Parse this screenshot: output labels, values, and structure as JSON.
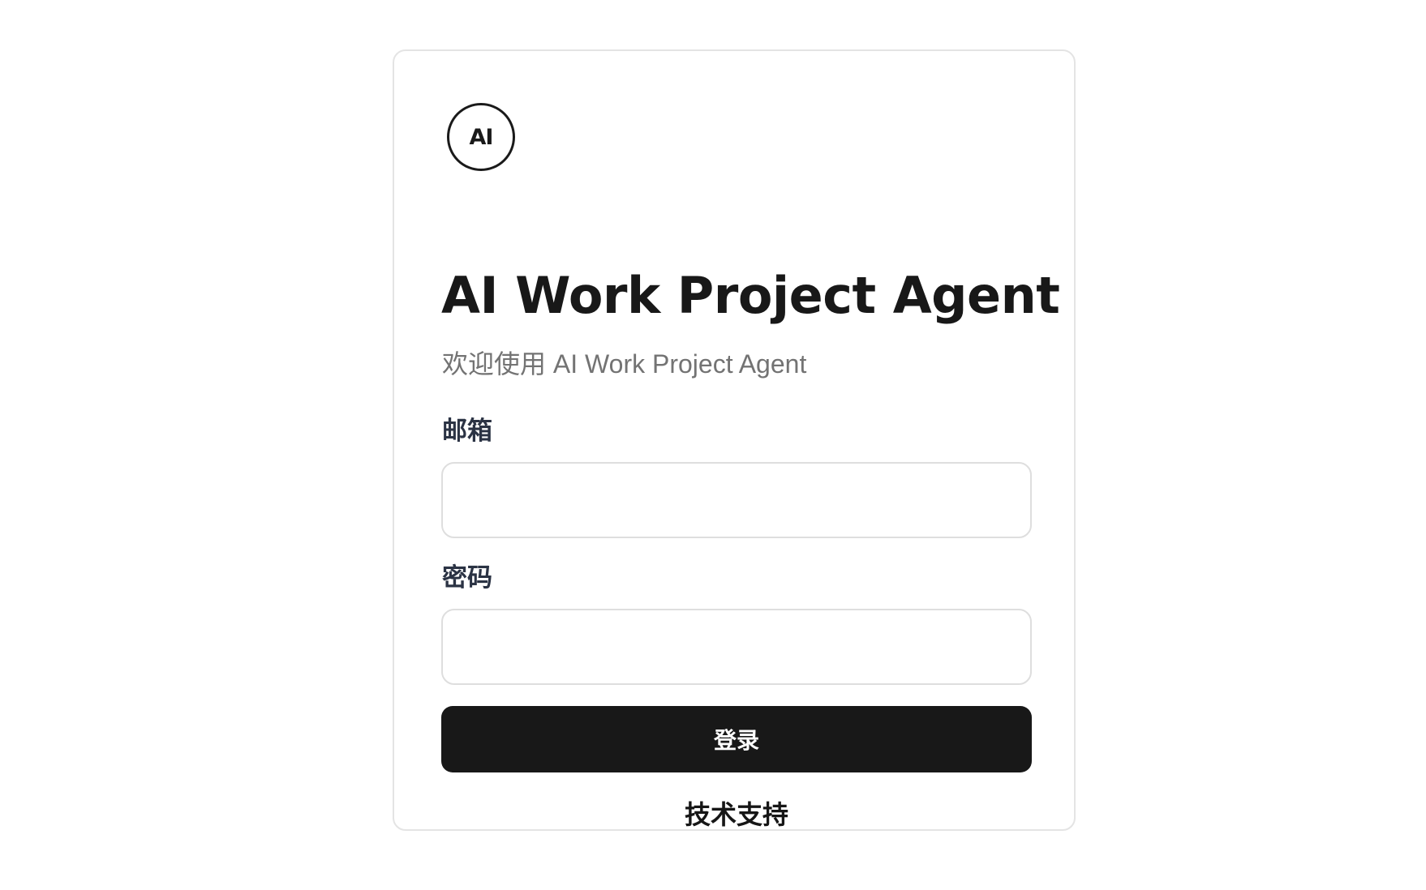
{
  "logo": {
    "text": "AI"
  },
  "login": {
    "title": "AI Work Project Agent",
    "subtitle": "欢迎使用 AI Work Project Agent",
    "email_label": "邮箱",
    "email_value": "",
    "email_placeholder": "",
    "password_label": "密码",
    "password_value": "",
    "password_placeholder": "",
    "submit_label": "登录",
    "support_link": "技术支持"
  },
  "colors": {
    "primary_button": "#181818",
    "label_text": "#2b3344",
    "subtitle_text": "#737373",
    "card_border": "#e4e4e4",
    "input_border": "#dedede"
  }
}
